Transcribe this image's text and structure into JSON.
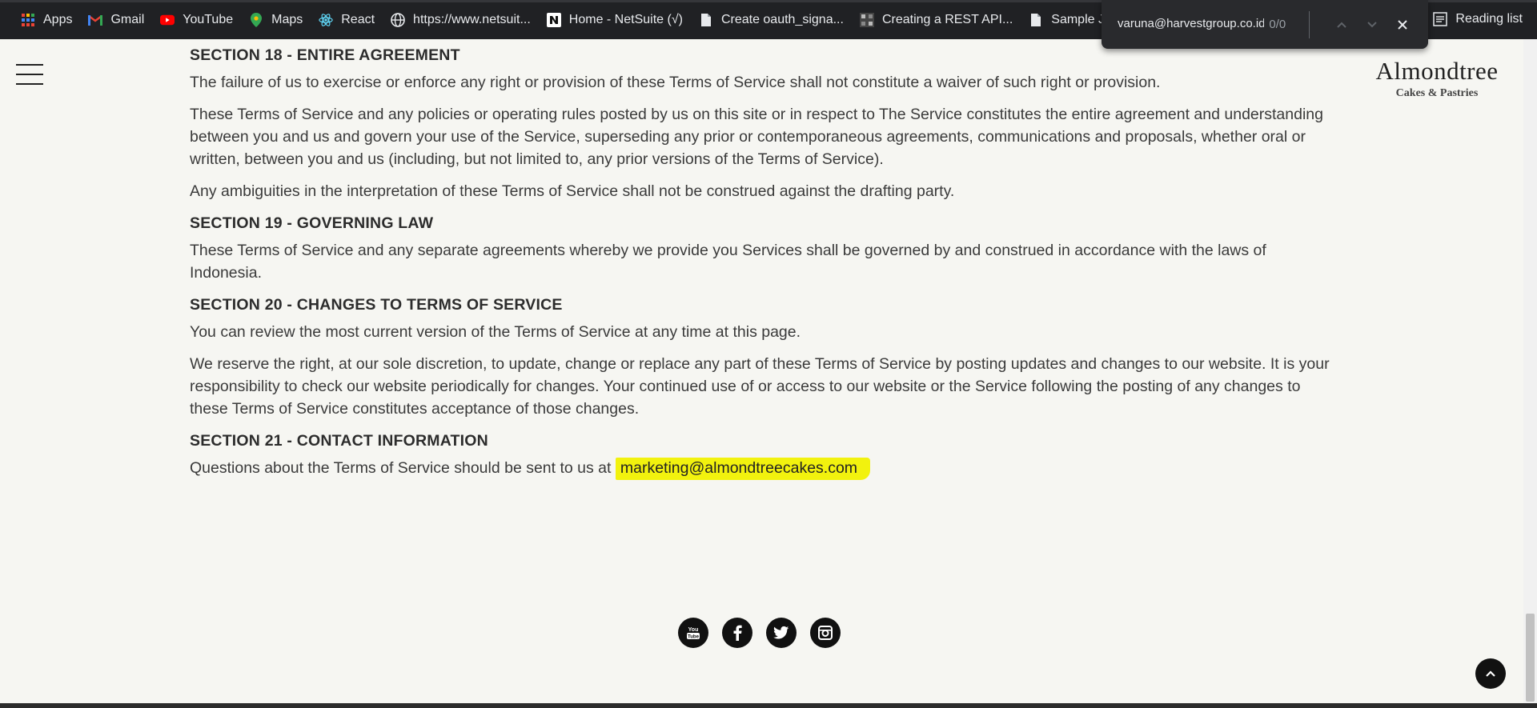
{
  "bookmarks": [
    {
      "label": "Apps",
      "icon": "apps-grid-icon"
    },
    {
      "label": "Gmail",
      "icon": "gmail-icon"
    },
    {
      "label": "YouTube",
      "icon": "youtube-icon"
    },
    {
      "label": "Maps",
      "icon": "maps-pin-icon"
    },
    {
      "label": "React",
      "icon": "react-icon"
    },
    {
      "label": "https://www.netsuit...",
      "icon": "globe-icon"
    },
    {
      "label": "Home - NetSuite (√)",
      "icon": "netsuite-icon"
    },
    {
      "label": "Create oauth_signa...",
      "icon": "document-icon"
    },
    {
      "label": "Creating a REST API...",
      "icon": "site-icon"
    },
    {
      "label": "Sample Java code",
      "icon": "document-icon"
    }
  ],
  "reading_list": {
    "label": "Reading list"
  },
  "find_bar": {
    "query": "varuna@harvestgroup.co.id",
    "match_count": "0/0"
  },
  "logo": {
    "main": "Almondtree",
    "sub": "Cakes & Pastries"
  },
  "content": {
    "s18_heading": "SECTION 18 - ENTIRE AGREEMENT",
    "s18_p1": "The failure of us to exercise or enforce any right or provision of these Terms of Service shall not constitute a waiver of such right or provision.",
    "s18_p2": "These Terms of Service and any policies or operating rules posted by us on this site or in respect to The Service constitutes the entire agreement and understanding between you and us and govern your use of the Service, superseding any prior or contemporaneous agreements, communications and proposals, whether oral or written, between you and us (including, but not limited to, any prior versions of the Terms of Service).",
    "s18_p3": "Any ambiguities in the interpretation of these Terms of Service shall not be construed against the drafting party.",
    "s19_heading": "SECTION 19 - GOVERNING LAW",
    "s19_p1": "These Terms of Service and any separate agreements whereby we provide you Services shall be governed by and construed in accordance with the laws of Indonesia.",
    "s20_heading": "SECTION 20 - CHANGES TO TERMS OF SERVICE",
    "s20_p1": "You can review the most current version of the Terms of Service at any time at this page.",
    "s20_p2": "We reserve the right, at our sole discretion, to update, change or replace any part of these Terms of Service by posting updates and changes to our website. It is your responsibility to check our website periodically for changes. Your continued use of or access to our website or the Service following the posting of any changes to these Terms of Service constitutes acceptance of those changes.",
    "s21_heading": "SECTION 21 - CONTACT INFORMATION",
    "s21_prefix": "Questions about the Terms of Service should be sent to us at",
    "s21_email": "marketing@almondtreecakes.com"
  },
  "social": [
    "youtube-icon",
    "facebook-icon",
    "twitter-icon",
    "instagram-icon"
  ],
  "colors": {
    "highlight": "#f2f20e",
    "chrome_dark": "#202124",
    "page_bg": "#f6f6f2"
  }
}
